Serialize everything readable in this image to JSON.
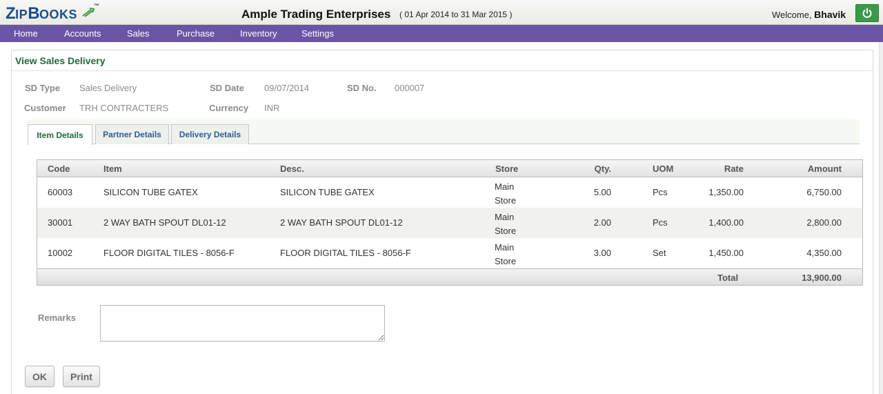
{
  "app": {
    "logo_big": "Z",
    "logo_small": "IP",
    "logo_big2": "B",
    "logo_small2": "OOKS",
    "logo_tm": "™",
    "company_name": "Ample Trading Enterprises",
    "period": "( 01 Apr 2014 to 31 Mar 2015 )",
    "welcome_text": "Welcome, ",
    "user_name": "Bhavik",
    "power_icon": "power-icon"
  },
  "nav": {
    "items": [
      "Home",
      "Accounts",
      "Sales",
      "Purchase",
      "Inventory",
      "Settings"
    ]
  },
  "page": {
    "title": "View Sales Delivery"
  },
  "form": {
    "sd_type_label": "SD Type",
    "sd_type_value": "Sales Delivery",
    "sd_date_label": "SD Date",
    "sd_date_value": "09/07/2014",
    "sd_no_label": "SD No.",
    "sd_no_value": "000007",
    "customer_label": "Customer",
    "customer_value": "TRH CONTRACTERS",
    "currency_label": "Currency",
    "currency_value": "INR"
  },
  "tabs": [
    "Item Details",
    "Partner Details",
    "Delivery Details"
  ],
  "grid": {
    "headers": [
      "Code",
      "Item",
      "Desc.",
      "Store",
      "Qty.",
      "UOM",
      "Rate",
      "Amount"
    ],
    "rows": [
      {
        "code": "60003",
        "item": "SILICON TUBE GATEX",
        "desc": "SILICON TUBE GATEX",
        "store1": "Main",
        "store2": "Store",
        "qty": "5.00",
        "uom": "Pcs",
        "rate": "1,350.00",
        "amount": "6,750.00"
      },
      {
        "code": "30001",
        "item": "2 WAY BATH SPOUT DL01-12",
        "desc": "2 WAY BATH SPOUT DL01-12",
        "store1": "Main",
        "store2": "Store",
        "qty": "2.00",
        "uom": "Pcs",
        "rate": "1,400.00",
        "amount": "2,800.00"
      },
      {
        "code": "10002",
        "item": "FLOOR DIGITAL TILES - 8056-F",
        "desc": "FLOOR DIGITAL TILES - 8056-F",
        "store1": "Main",
        "store2": "Store",
        "qty": "3.00",
        "uom": "Set",
        "rate": "1,450.00",
        "amount": "4,350.00"
      }
    ],
    "total_label": "Total",
    "total_value": "13,900.00"
  },
  "remarks": {
    "label": "Remarks",
    "value": ""
  },
  "buttons": {
    "ok": "OK",
    "print": "Print"
  },
  "colors": {
    "nav_bg": "#6a55a5",
    "title_green": "#1f6a3b",
    "power_green": "#3a9a47",
    "tab_blue": "#2b5d95"
  }
}
